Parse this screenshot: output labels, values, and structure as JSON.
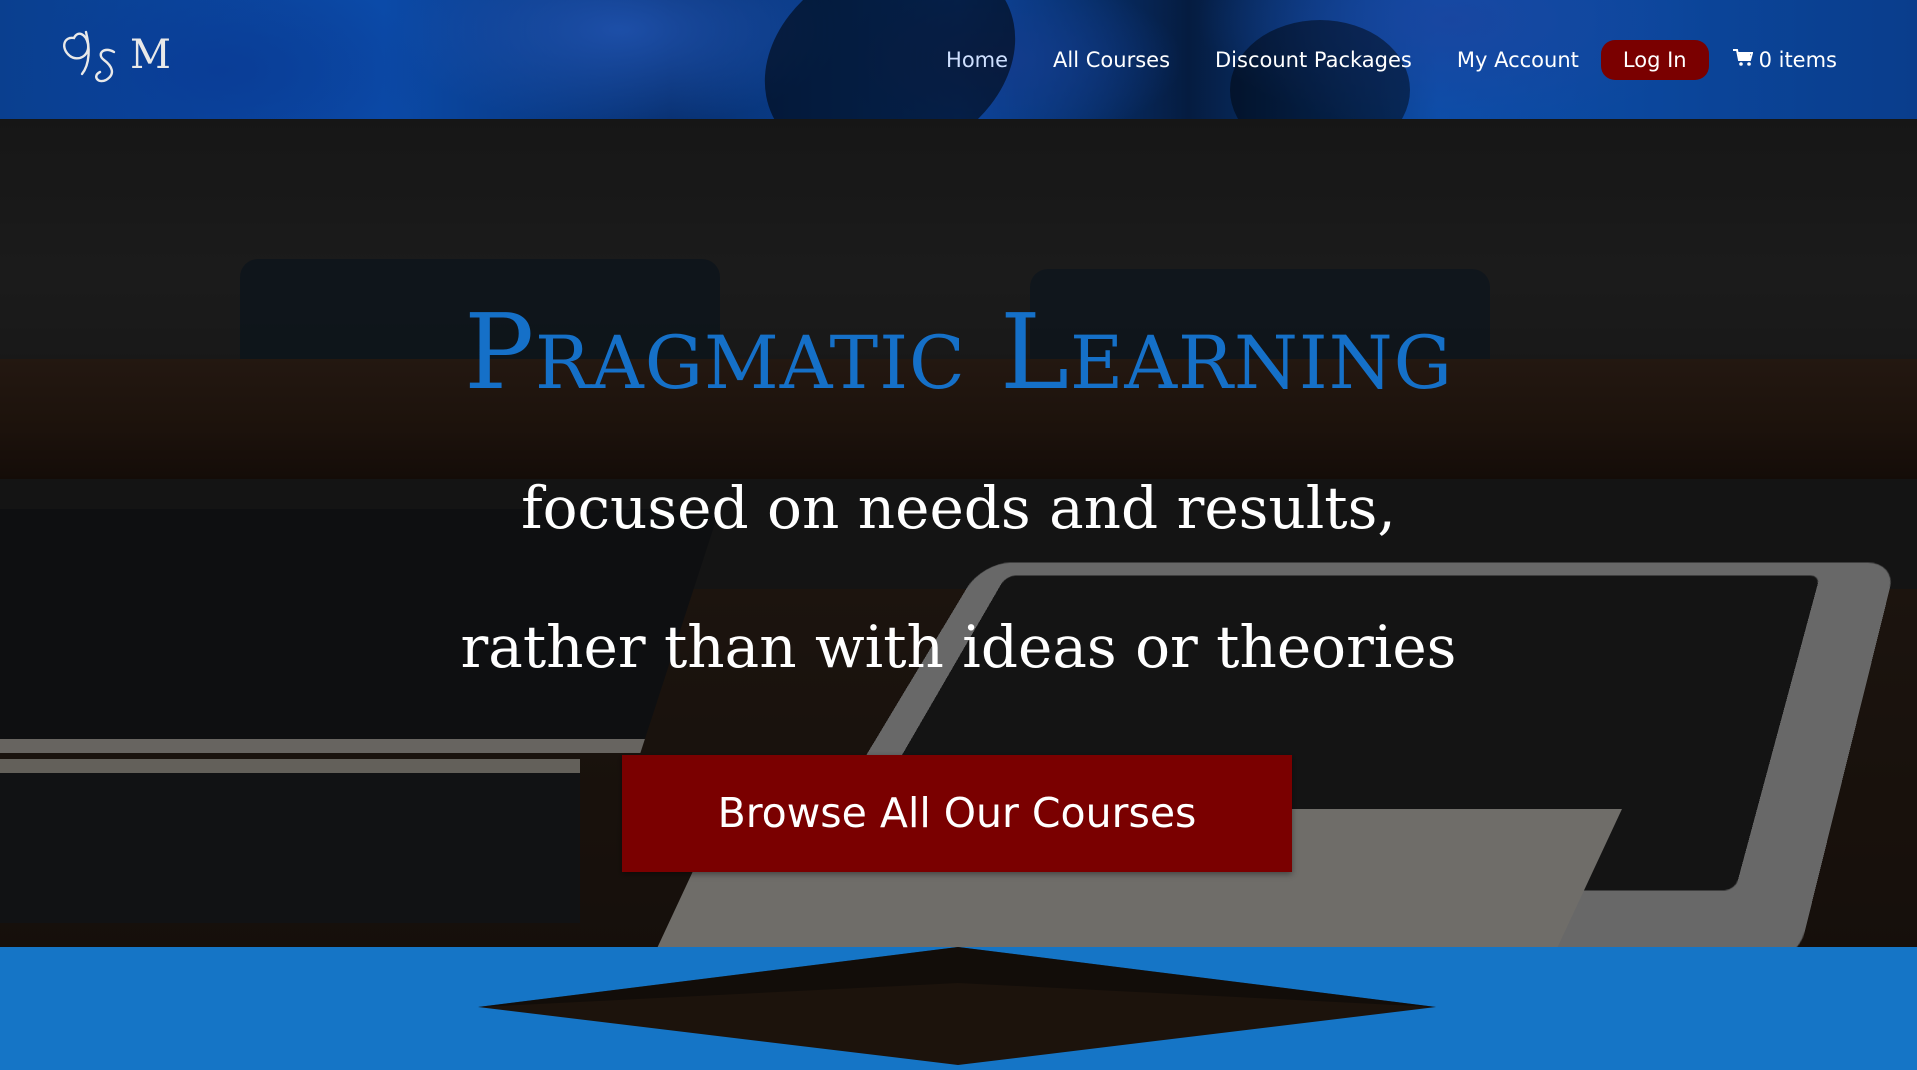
{
  "header": {
    "logo_text": "JSM",
    "nav": {
      "home": "Home",
      "all_courses": "All Courses",
      "discount_packages": "Discount Packages",
      "my_account": "My Account",
      "log_in": "Log In",
      "cart": "0 items"
    }
  },
  "hero": {
    "title": "Pragmatic Learning",
    "line1": "focused on needs and results,",
    "line2": "rather than with ideas or theories",
    "cta_label": "Browse All Our Courses"
  },
  "colors": {
    "accent_blue": "#1570c8",
    "button_red": "#7a0000",
    "band_blue": "#1575c6"
  },
  "icons": {
    "cart": "shopping-cart-icon",
    "logo": "jsm-monogram-logo"
  }
}
